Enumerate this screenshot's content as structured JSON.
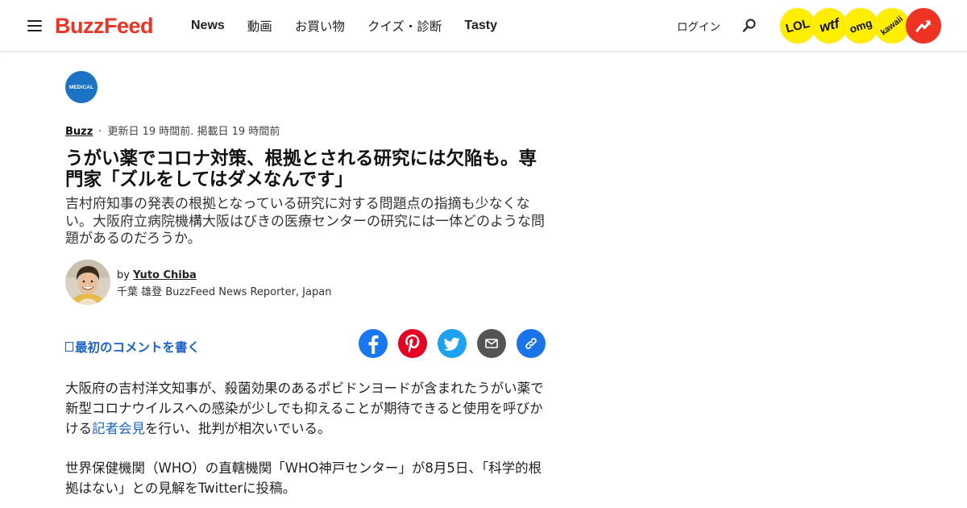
{
  "header": {
    "logo": "BuzzFeed",
    "nav": [
      {
        "label": "News",
        "bold": true
      },
      {
        "label": "動画",
        "bold": false
      },
      {
        "label": "お買い物",
        "bold": false
      },
      {
        "label": "クイズ・診断",
        "bold": false
      },
      {
        "label": "Tasty",
        "bold": true
      }
    ],
    "login": "ログイン",
    "badges": {
      "lol": "LOL",
      "wtf": "wtf",
      "omg": "omg",
      "kawaii": "kawaii"
    }
  },
  "article": {
    "category_badge": "MEDICAL",
    "category": "Buzz",
    "separator": "·",
    "timestamp": "更新日 19 時間前. 掲載日 19 時間前",
    "headline": "うがい薬でコロナ対策、根拠とされる研究には欠陥も。専門家「ズルをしてはダメなんです」",
    "dek": "吉村府知事の発表の根拠となっている研究に対する問題点の指摘も少なくない。大阪府立病院機構大阪はびきの医療センターの研究には一体どのような問題があるのだろうか。",
    "author": {
      "by": "by",
      "name": "Yuto Chiba",
      "role": "千葉 雄登 BuzzFeed News Reporter, Japan"
    },
    "comment_cta": "最初のコメントを書く",
    "body": {
      "p1_before": "大阪府の吉村洋文知事が、殺菌効果のあるポビドンヨードが含まれたうがい薬で新型コロナウイルスへの感染が少しでも抑えることが期待できると使用を呼びかける",
      "p1_link": "記者会見",
      "p1_after": "を行い、批判が相次いでいる。",
      "p2": "世界保健機関（WHO）の直轄機関「WHO神戸センター」が8月5日、「科学的根拠はない」との見解をTwitterに投稿。"
    }
  },
  "colors": {
    "brand": "#ee3322",
    "badge_yellow": "#ffee00",
    "link_blue": "#1a63c8",
    "medical_blue": "#1a73c4"
  },
  "icons": [
    "menu-icon",
    "search-icon",
    "trending-icon",
    "facebook-icon",
    "pinterest-icon",
    "twitter-icon",
    "mail-icon",
    "link-icon",
    "comment-icon"
  ]
}
